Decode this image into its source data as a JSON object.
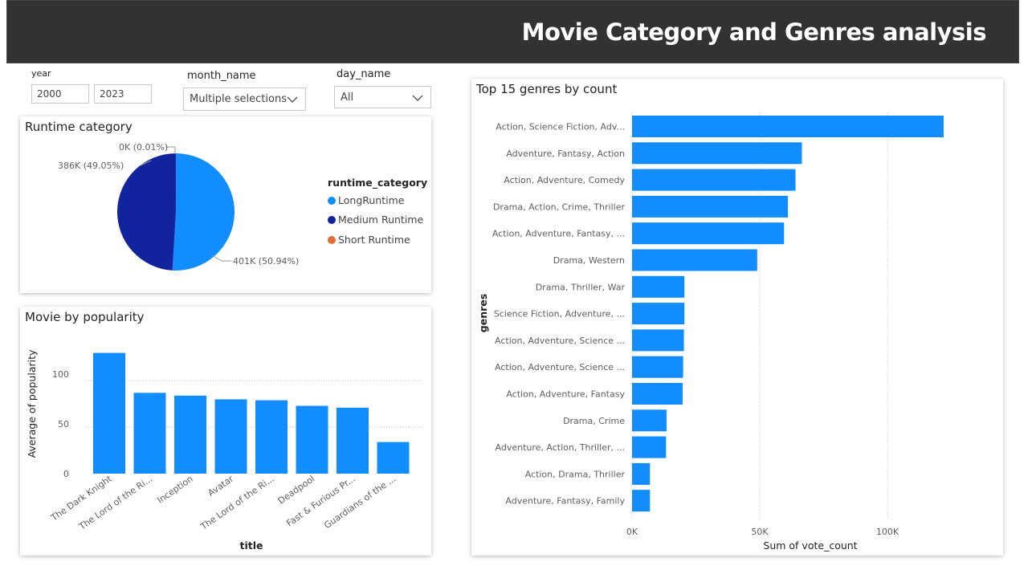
{
  "header": {
    "title": "Movie Category and Genres analysis"
  },
  "filters": {
    "year": {
      "label": "year",
      "from": "2000",
      "to": "2023"
    },
    "month": {
      "label": "month_name",
      "value": "Multiple selections"
    },
    "day": {
      "label": "day_name",
      "value": "All"
    }
  },
  "runtime_card": {
    "title": "Runtime category",
    "legend_title": "runtime_category",
    "slice_labels": [
      "401K (50.94%)",
      "386K (49.05%)",
      "0K (0.01%)"
    ],
    "legend": [
      {
        "name": "LongRuntime",
        "color": "#118dff"
      },
      {
        "name": "Medium Runtime",
        "color": "#12239e"
      },
      {
        "name": "Short Runtime",
        "color": "#e66c37"
      }
    ]
  },
  "popularity_card": {
    "title": "Movie by popularity",
    "xlabel": "title",
    "ylabel": "Average of popularity",
    "yticks": [
      "0",
      "50",
      "100"
    ]
  },
  "genres_card": {
    "title": "Top 15 genres by count",
    "xlabel": "Sum of vote_count",
    "ylabel": "genres",
    "xticks": [
      "0K",
      "50K",
      "100K"
    ]
  },
  "chart_data": [
    {
      "type": "pie",
      "title": "Runtime category",
      "legend_title": "runtime_category",
      "categories": [
        "LongRuntime",
        "Medium Runtime",
        "Short Runtime"
      ],
      "values": [
        401,
        386,
        0.08
      ],
      "percent": [
        50.94,
        49.05,
        0.01
      ],
      "colors": [
        "#118dff",
        "#12239e",
        "#e66c37"
      ],
      "legend": "right"
    },
    {
      "type": "bar",
      "title": "Movie by popularity",
      "xlabel": "title",
      "ylabel": "Average of popularity",
      "categories": [
        "The Dark Knight",
        "The Lord of the Ri...",
        "Inception",
        "Avatar",
        "The Lord of the Ri...",
        "Deadpool",
        "Fast & Furious Pr...",
        "Guardians of the ..."
      ],
      "values": [
        130,
        87,
        84,
        80,
        79,
        73,
        71,
        34
      ],
      "ylim": [
        0,
        140
      ],
      "color": "#118dff",
      "grid": true
    },
    {
      "type": "bar",
      "orientation": "horizontal",
      "title": "Top 15 genres by count",
      "xlabel": "Sum of vote_count",
      "ylabel": "genres",
      "categories": [
        "Action, Science Fiction, Adv...",
        "Adventure, Fantasy, Action",
        "Action, Adventure, Comedy",
        "Drama, Action, Crime, Thriller",
        "Action, Adventure, Fantasy, ...",
        "Drama, Western",
        "Drama, Thriller, War",
        "Science Fiction, Adventure, ...",
        "Action, Adventure, Science ...",
        "Action, Adventure, Science ...",
        "Action, Adventure, Fantasy",
        "Drama, Crime",
        "Adventure, Action, Thriller, ...",
        "Action, Drama, Thriller",
        "Adventure, Fantasy, Family"
      ],
      "values": [
        122000,
        66500,
        64000,
        61000,
        59500,
        49000,
        20500,
        20500,
        20300,
        20000,
        19800,
        13500,
        13300,
        7000,
        7000
      ],
      "xlim": [
        0,
        128000
      ],
      "color": "#118dff",
      "grid": true
    }
  ]
}
